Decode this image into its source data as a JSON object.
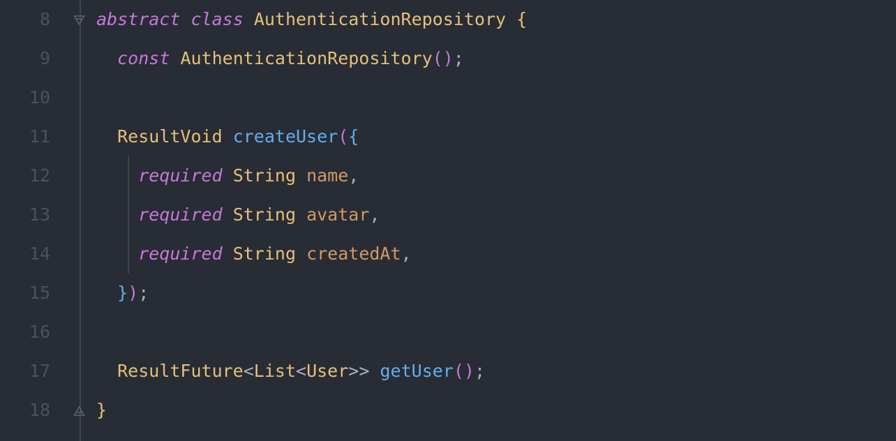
{
  "lineNumbers": [
    "8",
    "9",
    "10",
    "11",
    "12",
    "13",
    "14",
    "15",
    "16",
    "17",
    "18"
  ],
  "code": {
    "l8": {
      "abstract": "abstract",
      "class": "class",
      "name": "AuthenticationRepository",
      "brace": "{"
    },
    "l9": {
      "const": "const",
      "name": "AuthenticationRepository",
      "parens": "()",
      "semi": ";"
    },
    "l11": {
      "type": "ResultVoid",
      "method": "createUser",
      "open": "(",
      "brace": "{"
    },
    "l12": {
      "required": "required",
      "type": "String",
      "param": "name",
      "comma": ","
    },
    "l13": {
      "required": "required",
      "type": "String",
      "param": "avatar",
      "comma": ","
    },
    "l14": {
      "required": "required",
      "type": "String",
      "param": "createdAt",
      "comma": ","
    },
    "l15": {
      "brace": "}",
      "paren": ")",
      "semi": ";"
    },
    "l17": {
      "type": "ResultFuture",
      "lt1": "<",
      "list": "List",
      "lt2": "<",
      "user": "User",
      "gt2": ">",
      "gt1": ">",
      "method": "getUser",
      "parens": "()",
      "semi": ";"
    },
    "l18": {
      "brace": "}"
    }
  }
}
